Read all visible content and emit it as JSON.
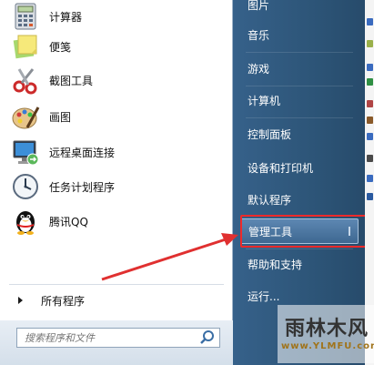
{
  "programs": [
    {
      "label": "计算器",
      "icon": "calculator-icon"
    },
    {
      "label": "便笺",
      "icon": "sticky-notes-icon"
    },
    {
      "label": "截图工具",
      "icon": "snipping-tool-icon"
    },
    {
      "label": "画图",
      "icon": "paint-icon"
    },
    {
      "label": "远程桌面连接",
      "icon": "remote-desktop-icon"
    },
    {
      "label": "任务计划程序",
      "icon": "task-scheduler-icon"
    },
    {
      "label": "腾讯QQ",
      "icon": "qq-penguin-icon"
    }
  ],
  "all_programs_label": "所有程序",
  "search": {
    "placeholder": "搜索程序和文件"
  },
  "right_menu": [
    {
      "label": "图片"
    },
    {
      "label": "音乐"
    },
    {
      "label": "游戏"
    },
    {
      "label": "计算机"
    },
    {
      "label": "控制面板"
    },
    {
      "label": "设备和打印机"
    },
    {
      "label": "默认程序"
    },
    {
      "label": "管理工具"
    },
    {
      "label": "帮助和支持"
    },
    {
      "label": "运行..."
    }
  ],
  "watermark": {
    "title": "雨林木风",
    "url": "www.YLMFU.com"
  },
  "colors": {
    "highlight_border": "#ee2a2a",
    "arrow": "#e03030",
    "right_pane": "#2d5578"
  }
}
